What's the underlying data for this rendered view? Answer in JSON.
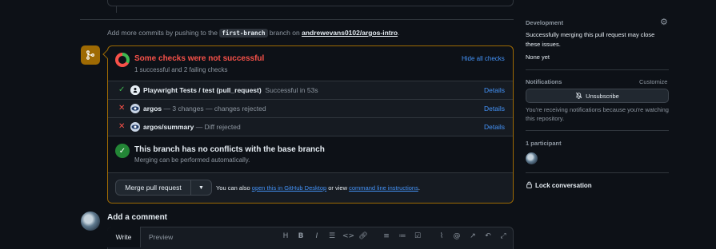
{
  "commit_hint": {
    "prefix": "Add more commits by pushing to the",
    "branch": "first-branch",
    "middle": "branch on",
    "repo": "andrewevans0102/argos-intro",
    "suffix": "."
  },
  "checks": {
    "title": "Some checks were not successful",
    "subtitle": "1 successful and 2 failing checks",
    "hide_label": "Hide all checks",
    "rows": [
      {
        "status": "success",
        "status_glyph": "✓",
        "name": "Playwright Tests / test (pull_request)",
        "desc": "Successful in 53s",
        "details": "Details"
      },
      {
        "status": "failure",
        "status_glyph": "✕",
        "name": "argos",
        "desc": "— 3 changes — changes rejected",
        "details": "Details"
      },
      {
        "status": "failure",
        "status_glyph": "✕",
        "name": "argos/summary",
        "desc": "— Diff rejected",
        "details": "Details"
      }
    ]
  },
  "conflicts": {
    "title": "This branch has no conflicts with the base branch",
    "subtitle": "Merging can be performed automatically."
  },
  "merge": {
    "button": "Merge pull request",
    "note_prefix": "You can also",
    "note_link1": "open this in GitHub Desktop",
    "note_middle": "or view",
    "note_link2": "command line instructions",
    "note_suffix": "."
  },
  "comment": {
    "heading": "Add a comment",
    "tab_write": "Write",
    "tab_preview": "Preview"
  },
  "sidebar": {
    "development": {
      "heading": "Development",
      "text": "Successfully merging this pull request may close these issues.",
      "none": "None yet"
    },
    "notifications": {
      "heading": "Notifications",
      "customize": "Customize",
      "button": "Unsubscribe",
      "text": "You're receiving notifications because you're watching this repository."
    },
    "participants": {
      "heading": "1 participant"
    },
    "lock": "Lock conversation"
  },
  "colors": {
    "accent_link": "#4493f8",
    "failure": "#f85149",
    "success": "#3fb950",
    "attention_border": "#9e6a03"
  }
}
